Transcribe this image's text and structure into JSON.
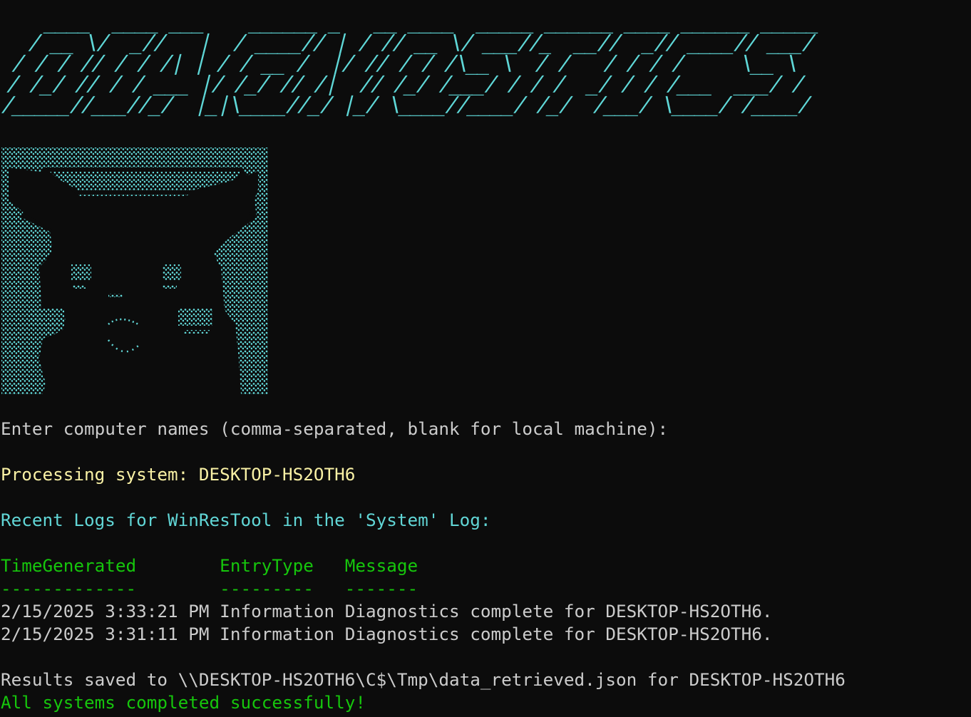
{
  "colors": {
    "background": "#0c0c0c",
    "default_text": "#cccccc",
    "banner": "#5fd7d7",
    "yellow": "#f9f1a5",
    "cyan": "#61d6d6",
    "green": "#16c60c"
  },
  "banner": {
    "text": "  ____  ____ ___    ______ _   __ ____  _____ ______ ____ ______ _____\n / __ \\/  _//   |  / ____// | / // __ \\/ ___//_  __//  _// ____// ___/\n/ / / // / / /| | / / __ /  |/ // / / /\\__ \\  / /   / / / /     \\__ \\ \n/ /_/ // / / ___ |/ /_/ // /|  // /_/ /___/ / / /  _/ / / /___  ___/ / \n/_____//___//_/  |_|\\____//_/ |_/ \\____//____/ /_/  /___/ \\____/ /____/"
  },
  "prompt": {
    "text": "Enter computer names (comma-separated, blank for local machine):"
  },
  "processing": {
    "text": "Processing system: DESKTOP-HS2OTH6"
  },
  "recent_logs": {
    "text": "Recent Logs for WinResTool in the 'System' Log:"
  },
  "log_table": {
    "header": "TimeGenerated        EntryType   Message",
    "separator": "-------------        ---------   -------",
    "rows": [
      "2/15/2025 3:33:21 PM Information Diagnostics complete for DESKTOP-HS2OTH6.",
      "2/15/2025 3:31:11 PM Information Diagnostics complete for DESKTOP-HS2OTH6."
    ]
  },
  "results": {
    "text": "Results saved to \\\\DESKTOP-HS2OTH6\\C$\\Tmp\\data_retrieved.json for DESKTOP-HS2OTH6"
  },
  "completion": {
    "text": "All systems completed successfully!"
  }
}
